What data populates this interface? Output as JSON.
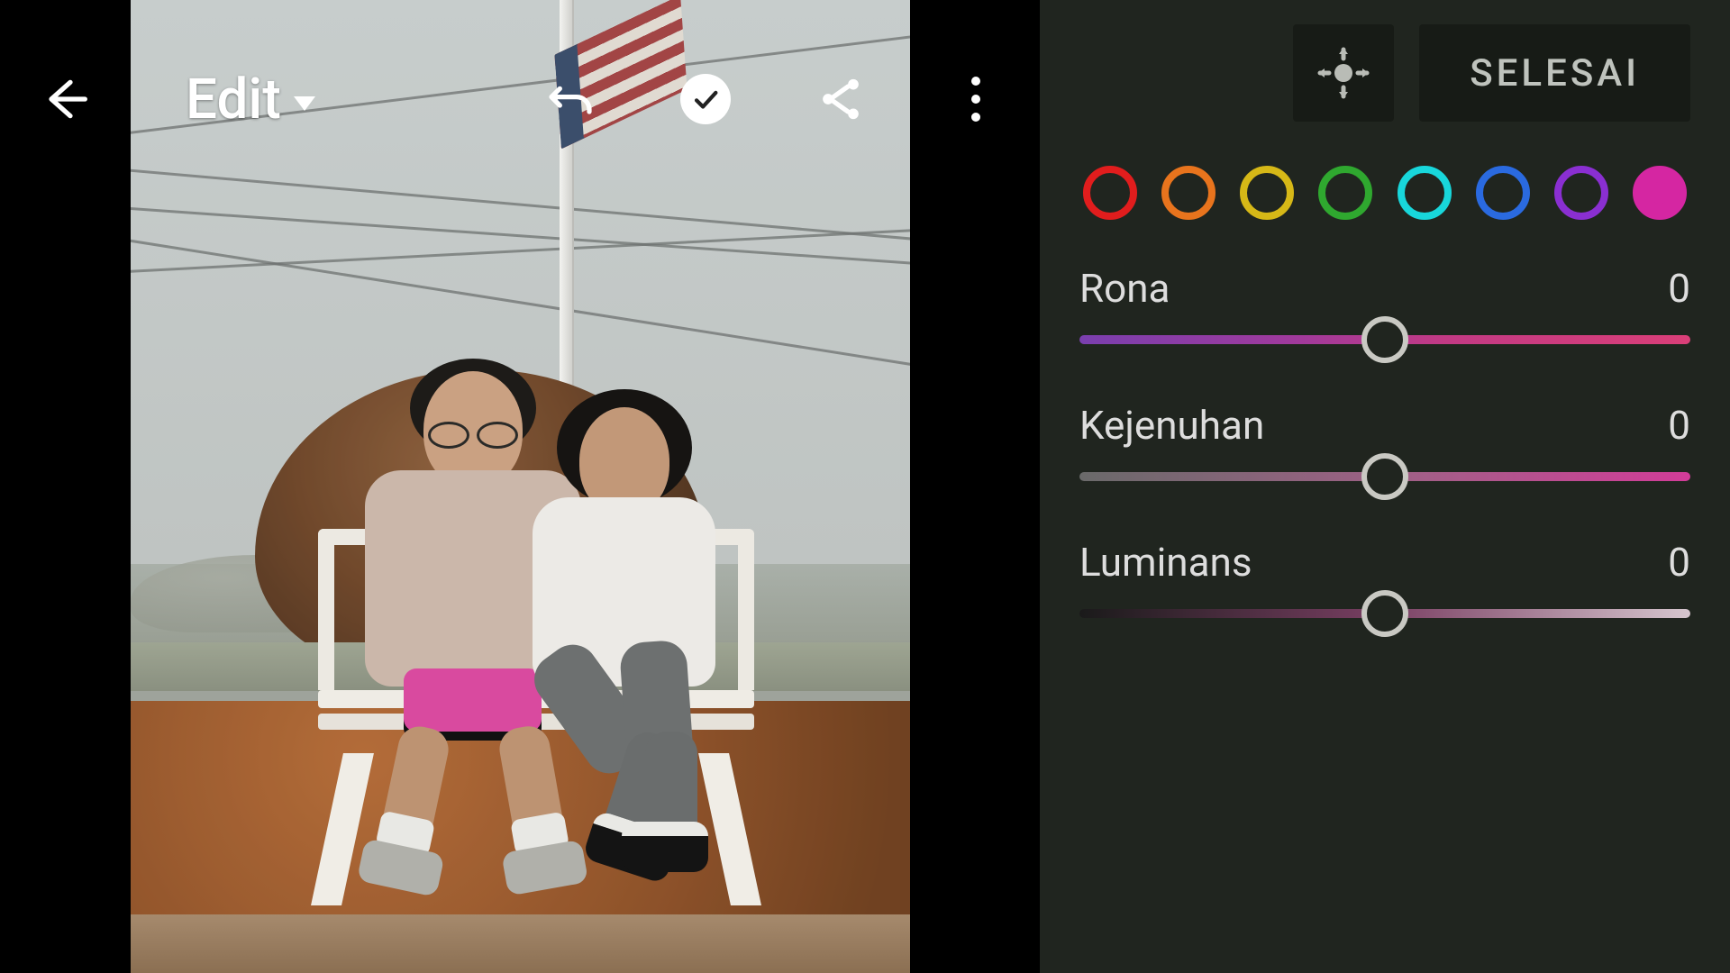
{
  "header": {
    "mode_label": "Edit",
    "done_label": "SELESAI"
  },
  "color_swatches": [
    {
      "name": "red",
      "hex": "#e11d1d"
    },
    {
      "name": "orange",
      "hex": "#e8741d"
    },
    {
      "name": "yellow",
      "hex": "#d6b817"
    },
    {
      "name": "green",
      "hex": "#2fa82f"
    },
    {
      "name": "aqua",
      "hex": "#18d7db"
    },
    {
      "name": "blue",
      "hex": "#2a6ae0"
    },
    {
      "name": "purple",
      "hex": "#8a2fd1"
    },
    {
      "name": "magenta",
      "hex": "#d526a2"
    }
  ],
  "selected_swatch_index": 7,
  "sliders": {
    "rona": {
      "label": "Rona",
      "value": 0,
      "min": -100,
      "max": 100
    },
    "kejenuhan": {
      "label": "Kejenuhan",
      "value": 0,
      "min": -100,
      "max": 100
    },
    "luminans": {
      "label": "Luminans",
      "value": 0,
      "min": -100,
      "max": 100
    }
  }
}
